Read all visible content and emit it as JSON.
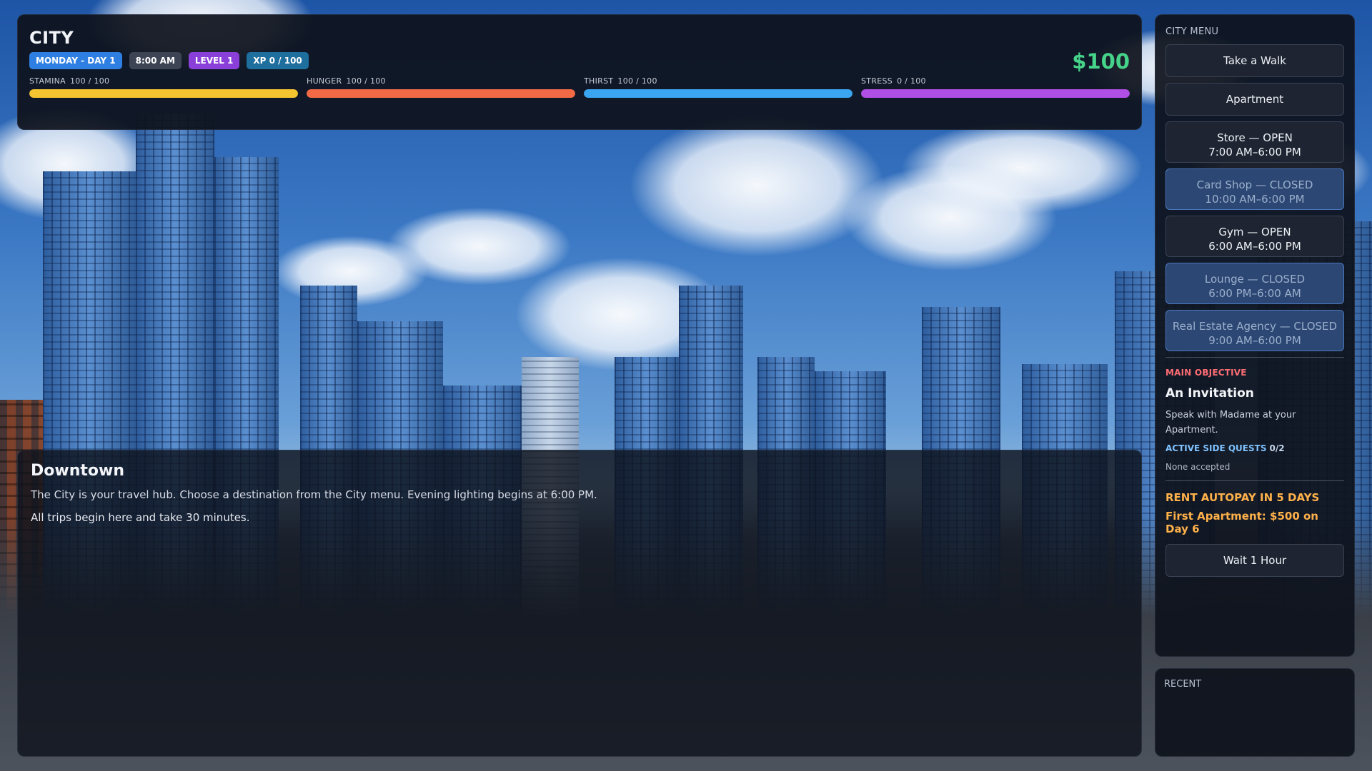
{
  "header": {
    "title": "CITY",
    "money": "$100",
    "badges": {
      "day": "MONDAY - DAY 1",
      "time": "8:00 AM",
      "level": "LEVEL 1",
      "xp": "XP 0 / 100"
    },
    "stats": [
      {
        "label": "STAMINA",
        "value": "100 / 100",
        "fraction": 1.0,
        "color": "#f5c531"
      },
      {
        "label": "HUNGER",
        "value": "100 / 100",
        "fraction": 1.0,
        "color": "#f26a45"
      },
      {
        "label": "THIRST",
        "value": "100 / 100",
        "fraction": 1.0,
        "color": "#3aa5f0"
      },
      {
        "label": "STRESS",
        "value": "0 / 100",
        "fraction": 1.0,
        "color": "#b04fe6"
      }
    ]
  },
  "city_menu": {
    "heading": "CITY MENU",
    "items": [
      {
        "line1": "Take a Walk",
        "line2": ""
      },
      {
        "line1": "Apartment",
        "line2": ""
      },
      {
        "line1": "Store — OPEN",
        "line2": "7:00 AM–6:00 PM"
      },
      {
        "line1": "Card Shop — CLOSED",
        "line2": "10:00 AM–6:00 PM"
      },
      {
        "line1": "Gym — OPEN",
        "line2": "6:00 AM–6:00 PM"
      },
      {
        "line1": "Lounge — CLOSED",
        "line2": "6:00 PM–6:00 AM"
      },
      {
        "line1": "Real Estate Agency — CLOSED",
        "line2": "9:00 AM–6:00 PM"
      }
    ]
  },
  "objective": {
    "heading": "MAIN OBJECTIVE",
    "title": "An Invitation",
    "text": "Speak with Madame at your Apartment.",
    "side_quests_label": "ACTIVE SIDE QUESTS",
    "side_quests_count": "0/2",
    "side_quests_none": "None accepted"
  },
  "rent": {
    "autopay": "RENT AUTOPAY IN 5 DAYS",
    "first": "First Apartment: $500 on Day 6"
  },
  "wait_button": "Wait 1 Hour",
  "recent": {
    "heading": "RECENT"
  },
  "location": {
    "title": "Downtown",
    "text": "The City is your travel hub. Choose a destination from the City menu. Evening lighting begins at 6:00 PM.",
    "text2": "All trips begin here and take 30 minutes."
  }
}
